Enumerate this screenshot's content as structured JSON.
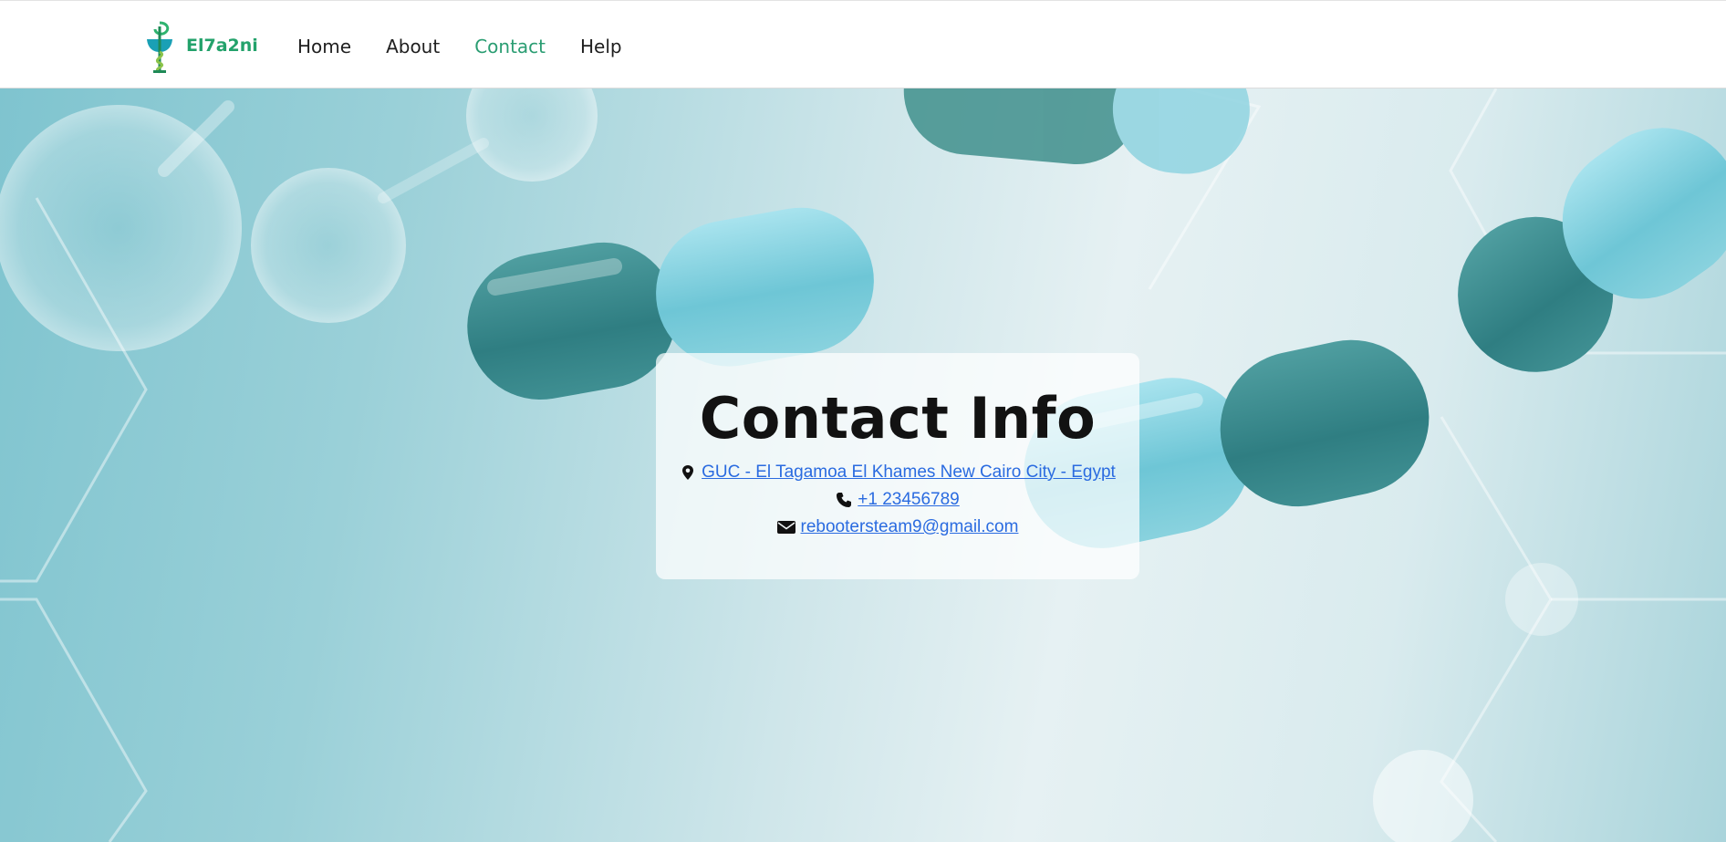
{
  "brand": {
    "name": "El7a2ni",
    "logo_icon": "pharmacy-bowl-snake-icon"
  },
  "nav": {
    "items": [
      {
        "label": "Home",
        "active": false
      },
      {
        "label": "About",
        "active": false
      },
      {
        "label": "Contact",
        "active": true
      },
      {
        "label": "Help",
        "active": false
      }
    ]
  },
  "contact": {
    "title": "Contact Info",
    "address": {
      "icon": "map-marker-icon",
      "text": "GUC - El Tagamoa El Khames New Cairo City - Egypt"
    },
    "phone": {
      "icon": "phone-icon",
      "text": "+1 23456789"
    },
    "email": {
      "icon": "envelope-icon",
      "text": "rebootersteam9@gmail.com"
    }
  },
  "colors": {
    "brand": "#23a26b",
    "nav_active": "#2a9d72",
    "link": "#2a6be0"
  }
}
